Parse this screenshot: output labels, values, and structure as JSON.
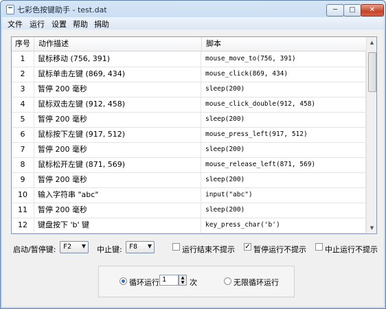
{
  "window": {
    "title": "七彩色按键助手 - test.dat",
    "min": "─",
    "max": "□",
    "close": "✕"
  },
  "menu": [
    "文件",
    "运行",
    "设置",
    "帮助",
    "捐助"
  ],
  "table": {
    "headers": [
      "序号",
      "动作描述",
      "脚本"
    ],
    "rows": [
      [
        "1",
        "鼠标移动 (756, 391)",
        "mouse_move_to(756, 391)"
      ],
      [
        "2",
        "鼠标单击左键 (869, 434)",
        "mouse_click(869, 434)"
      ],
      [
        "3",
        "暂停 200 毫秒",
        "sleep(200)"
      ],
      [
        "4",
        "鼠标双击左键 (912, 458)",
        "mouse_click_double(912, 458)"
      ],
      [
        "5",
        "暂停 200 毫秒",
        "sleep(200)"
      ],
      [
        "6",
        "鼠标按下左键 (917, 512)",
        "mouse_press_left(917, 512)"
      ],
      [
        "7",
        "暂停 200 毫秒",
        "sleep(200)"
      ],
      [
        "8",
        "鼠标松开左键 (871, 569)",
        "mouse_release_left(871, 569)"
      ],
      [
        "9",
        "暂停 200 毫秒",
        "sleep(200)"
      ],
      [
        "10",
        "输入字符串 \"abc\"",
        "input(\"abc\")"
      ],
      [
        "11",
        "暂停 200 毫秒",
        "sleep(200)"
      ],
      [
        "12",
        "键盘按下 'b' 键",
        "key_press_char('b')"
      ]
    ]
  },
  "controls": {
    "start_pause_label": "启动/暂停键:",
    "start_pause_value": "F2",
    "stop_label": "中止键:",
    "stop_value": "F8",
    "opt_end_no_prompt": "运行结束不提示",
    "opt_pause_no_prompt": "暂停运行不提示",
    "opt_stop_no_prompt": "中止运行不提示",
    "check_mark": "✓"
  },
  "loop": {
    "loop_label": "循环运行",
    "loop_count": "1",
    "times_label": "次",
    "infinite_label": "无限循环运行",
    "spin_up": "▲",
    "spin_down": "▼"
  },
  "scrollbar": {
    "up": "▲",
    "down": "▼"
  }
}
